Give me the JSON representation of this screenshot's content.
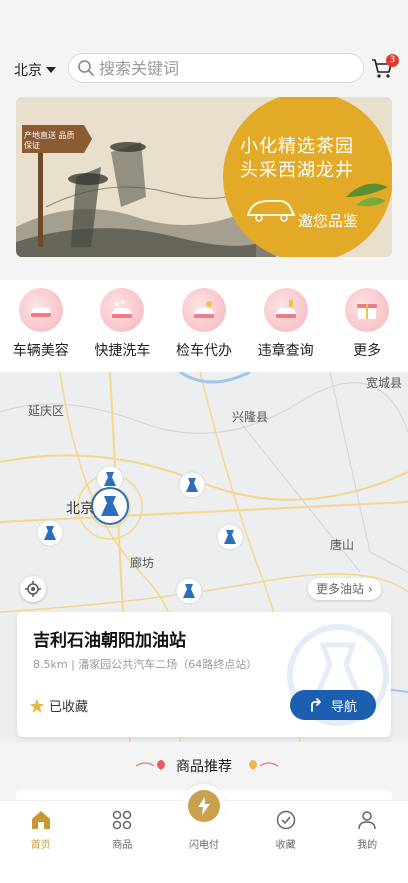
{
  "header": {
    "city": "北京",
    "search_placeholder": "搜索关键词",
    "cart_count": "3"
  },
  "banner": {
    "sign_text": "产地直送 品质保证",
    "line1": "小化精选茶园",
    "line2": "头采西湖龙井",
    "sub": "邀您品鉴"
  },
  "services": [
    {
      "label": "车辆美容",
      "icon": "car-wash-beauty-icon"
    },
    {
      "label": "快捷洗车",
      "icon": "quick-wash-icon"
    },
    {
      "label": "检车代办",
      "icon": "inspection-icon"
    },
    {
      "label": "违章查询",
      "icon": "violation-query-icon"
    },
    {
      "label": "更多",
      "icon": "more-icon"
    }
  ],
  "map": {
    "labels": {
      "yanqing": "延庆区",
      "xinglong": "兴隆县",
      "kuancheng": "宽城县",
      "beijing": "北京",
      "langfang": "廊坊",
      "tangshan": "唐山"
    },
    "more_stations": "更多油站"
  },
  "station": {
    "name": "吉利石油朝阳加油站",
    "distance": "8.5km",
    "address": "潘家园公共汽车二场（64路终点站）",
    "favorite_label": "已收藏",
    "nav_label": "导航"
  },
  "recommend": {
    "title": "商品推荐"
  },
  "tabs": [
    {
      "label": "首页",
      "icon": "home-icon",
      "active": true
    },
    {
      "label": "商品",
      "icon": "grid-icon",
      "active": false
    },
    {
      "label": "闪电付",
      "icon": "lightning-icon",
      "active": false
    },
    {
      "label": "收藏",
      "icon": "favorite-icon",
      "active": false
    },
    {
      "label": "我的",
      "icon": "profile-icon",
      "active": false
    }
  ],
  "colors": {
    "accent_gold": "#c59a33",
    "nav_blue": "#1c5fb1",
    "badge_red": "#e23a2e"
  }
}
